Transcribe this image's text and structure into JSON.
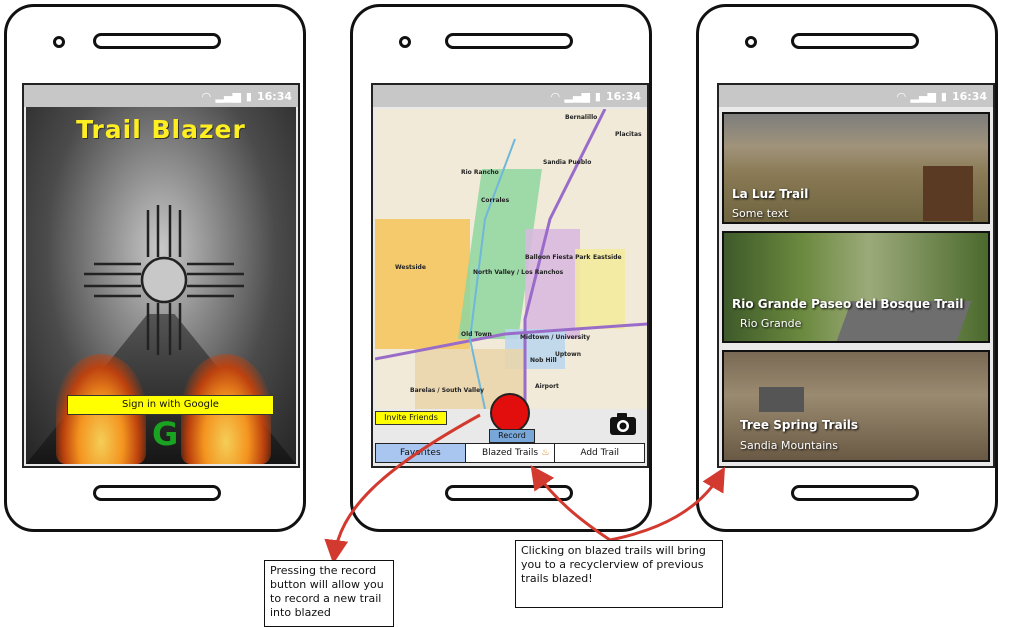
{
  "status": {
    "time": "16:34"
  },
  "login": {
    "app_title": "Trail Blazer",
    "signin_label": "Sign in with Google",
    "google_glyph": "G"
  },
  "record": {
    "invite_label": "Invite Friends",
    "record_label": "Record",
    "tabs": [
      "Favorites",
      "Blazed Trails",
      "Add Trail"
    ],
    "active_tab": "Favorites",
    "map_labels": [
      "Bernalillo",
      "Placitas",
      "Sandia Pueblo",
      "Rio Rancho",
      "Corrales",
      "Westside",
      "North Valley / Los Ranchos",
      "Balloon Fiesta Park",
      "Eastside",
      "Old Town",
      "Midtown / University",
      "Uptown",
      "Nob Hill",
      "Airport",
      "Barelas / South Valley"
    ]
  },
  "trails": {
    "items": [
      {
        "name": "La Luz Trail",
        "subtitle": "Some text"
      },
      {
        "name": "Rio Grande Paseo del Bosque Trail",
        "subtitle": "Rio Grande"
      },
      {
        "name": "Tree Spring Trails",
        "subtitle": "Sandia Mountains"
      }
    ]
  },
  "annotations": {
    "record_note": "Pressing the record button will allow you to record a new trail into blazed",
    "blazed_note": "Clicking on blazed trails will bring you to a recyclerview of previous trails blazed!"
  },
  "colors": {
    "accent_yellow": "#ffff00",
    "record_red": "#e20d0d",
    "tab_active": "#a8c6f0",
    "annotation_arrow": "#d23a2f"
  },
  "icons": [
    "wifi-icon",
    "signal-icon",
    "battery-icon",
    "zia-sun-icon",
    "google-icon",
    "camera-icon",
    "fire-icon"
  ]
}
